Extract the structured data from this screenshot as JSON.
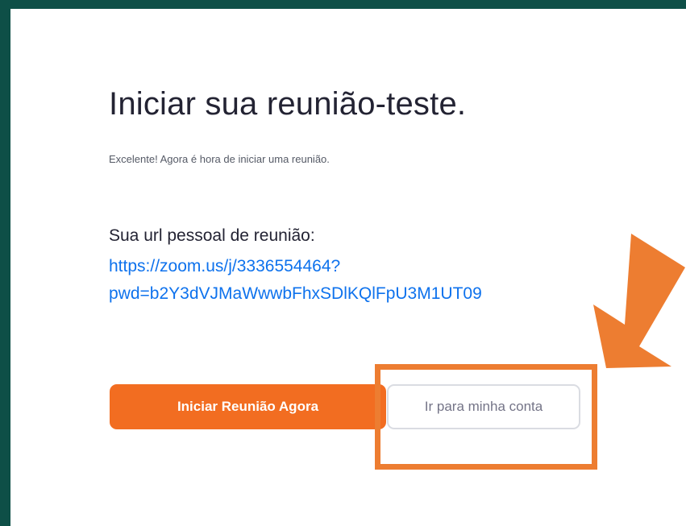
{
  "page": {
    "title": "Iniciar sua reunião-teste.",
    "subtitle": "Excelente! Agora é hora de iniciar uma reunião.",
    "url_label": "Sua url pessoal de reunião:",
    "url_line_1": "https://zoom.us/j/3336554464?",
    "url_line_2": "pwd=b2Y3dVJMaWwwbFhxSDlKQlFpU3M1UT09"
  },
  "buttons": {
    "start_label": "Iniciar Reunião Agora",
    "account_label": "Ir para minha conta"
  },
  "colors": {
    "frame": "#0e4f47",
    "accent_orange": "#f26d21",
    "annotation_orange": "#ed7d31",
    "link_blue": "#0e72ed"
  },
  "icons": {
    "annotation_arrow": "arrow-down-left-icon"
  }
}
